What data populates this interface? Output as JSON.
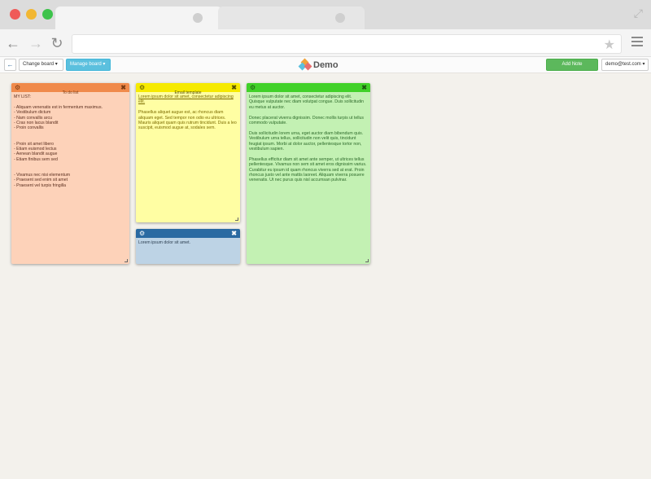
{
  "browser": {
    "address": ""
  },
  "toolbar": {
    "back_label": "←",
    "change_board_label": "Change board ▾",
    "manage_board_label": "Manage board ▾",
    "brand_title": "Demo",
    "add_note_label": "Add Note",
    "user_label": "demo@test.com ▾"
  },
  "colors": {
    "note_orange": "#f08a4b",
    "note_yellow": "#f6ea00",
    "note_blue": "#2a6aa2",
    "note_green": "#41d129",
    "add_note": "#5cb85c",
    "manage_board": "#5bc0de"
  },
  "notes": [
    {
      "title": "To do list",
      "body": [
        "MY LIST:",
        "",
        "- Aliquam venenatis est in fermentum maximus.",
        "- Vestibulum dictum",
        "- Nam convallis arcu",
        "- Cras non lacus blandit",
        "- Proin convallis",
        "",
        "",
        "- Proin sit amet libero",
        "- Etiam euismod lectus",
        "- Aenean blandit augue",
        "- Etiam finibus sem sed",
        "",
        "",
        "- Vivamus nec nisi elementum",
        "- Praesent sed enim sit amet",
        "- Praesent vel turpis fringilla"
      ]
    },
    {
      "title": "Email template",
      "body": [
        "Lorem ipsum dolor sit amet, consectetur adipiscing elit.",
        "Phasellus aliquet augue est, ac rhoncus diam aliquam eget. Sed tempor non odio eu ultrices. Mauris aliquet quam quis rutrum tincidunt. Duis a leo suscipit, euismod augue at, sodales sem."
      ]
    },
    {
      "title": "",
      "body": [
        "Lorem ipsum dolor sit amet."
      ]
    },
    {
      "title": "",
      "body": [
        "Lorem ipsum dolor sit amet, consectetur adipiscing elit. Quisque vulputate nec diam volutpat congue. Duis sollicitudin eu metus at auctor.",
        "Donec placerat viverra dignissim. Donec mollis turpis ut tellus commodo vulputate.",
        "Duis sollicitudin lorem urna, eget auctor diam bibendum quis. Vestibulum urna tellus, sollicitudin non velit quis, tincidunt feugiat ipsum. Morbi at dolor auctor, pellentesque tortor non, vestibulum sapien.",
        "Phasellus efficitur diam sit amet ante semper, ut ultrices tellus pellentesque. Vivamus non sem sit amet eros dignissim varius. Curabitur eu ipsum id quam rhoncus viverra sed at erat. Proin rhoncus justo vel ante mattis laoreet. Aliquam viverra posuere venenatis. Ut nec purus quis nisl accumsan pulvinar."
      ]
    }
  ]
}
